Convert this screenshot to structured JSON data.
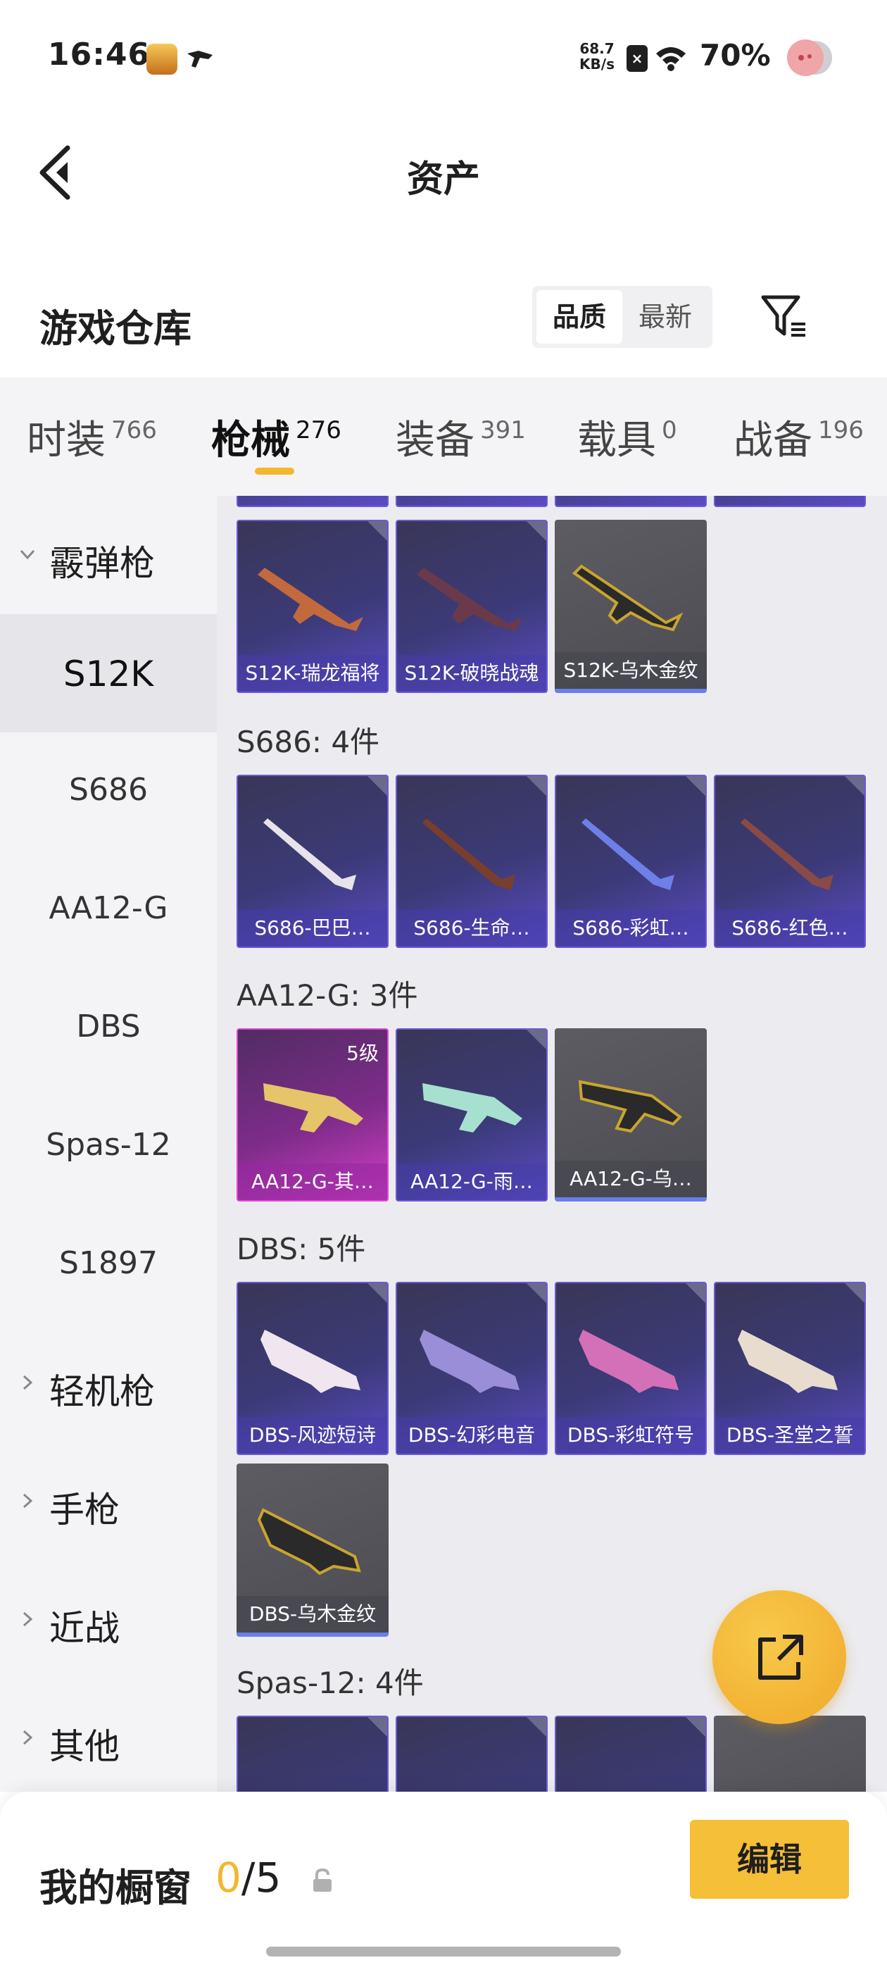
{
  "status_bar": {
    "time": "16:46",
    "net_speed_value": "68.7",
    "net_speed_unit": "KB/s",
    "battery": "70%"
  },
  "header": {
    "title": "资产"
  },
  "warehouse": {
    "title": "游戏仓库",
    "sort_options": [
      "品质",
      "最新"
    ],
    "sort_selected": "品质"
  },
  "category_tabs": [
    {
      "label": "时装",
      "count": "766"
    },
    {
      "label": "枪械",
      "count": "276"
    },
    {
      "label": "装备",
      "count": "391"
    },
    {
      "label": "载具",
      "count": "0"
    },
    {
      "label": "战备",
      "count": "196"
    }
  ],
  "active_tab": "枪械",
  "sidebar": {
    "items": [
      {
        "label": "霰弹枪",
        "type": "group-expanded"
      },
      {
        "label": "S12K",
        "type": "sub-selected"
      },
      {
        "label": "S686",
        "type": "sub"
      },
      {
        "label": "AA12-G",
        "type": "sub"
      },
      {
        "label": "DBS",
        "type": "sub"
      },
      {
        "label": "Spas-12",
        "type": "sub"
      },
      {
        "label": "S1897",
        "type": "sub"
      },
      {
        "label": "轻机枪",
        "type": "group"
      },
      {
        "label": "手枪",
        "type": "group"
      },
      {
        "label": "近战",
        "type": "group"
      },
      {
        "label": "其他",
        "type": "group"
      }
    ]
  },
  "sections": {
    "s12k_items": [
      {
        "name": "S12K-瑞龙福将",
        "rarity": "purple"
      },
      {
        "name": "S12K-破晓战魂",
        "rarity": "purple"
      },
      {
        "name": "S12K-乌木金纹",
        "rarity": "gray"
      }
    ],
    "s686": {
      "label": "S686: 4件",
      "items": [
        {
          "name": "S686-巴巴…",
          "rarity": "purple"
        },
        {
          "name": "S686-生命…",
          "rarity": "purple"
        },
        {
          "name": "S686-彩虹…",
          "rarity": "purple"
        },
        {
          "name": "S686-红色…",
          "rarity": "purple"
        }
      ]
    },
    "aa12g": {
      "label": "AA12-G: 3件",
      "items": [
        {
          "name": "AA12-G-其…",
          "rarity": "pink",
          "level": "5级"
        },
        {
          "name": "AA12-G-雨…",
          "rarity": "purple"
        },
        {
          "name": "AA12-G-乌…",
          "rarity": "gray"
        }
      ]
    },
    "dbs": {
      "label": "DBS: 5件",
      "items": [
        {
          "name": "DBS-风迹短诗",
          "rarity": "purple"
        },
        {
          "name": "DBS-幻彩电音",
          "rarity": "purple"
        },
        {
          "name": "DBS-彩虹符号",
          "rarity": "purple"
        },
        {
          "name": "DBS-圣堂之誓",
          "rarity": "purple"
        },
        {
          "name": "DBS-乌木金纹",
          "rarity": "gray"
        }
      ]
    },
    "spas12": {
      "label": "Spas-12: 4件"
    }
  },
  "showcase": {
    "label": "我的橱窗",
    "current": "0",
    "total": "/5",
    "edit_label": "编辑"
  },
  "colors": {
    "accent": "#f3b72e",
    "purple_rarity": "#5b4bc4",
    "pink_rarity": "#d43fc6",
    "gray_rarity": "#4c4c52"
  }
}
